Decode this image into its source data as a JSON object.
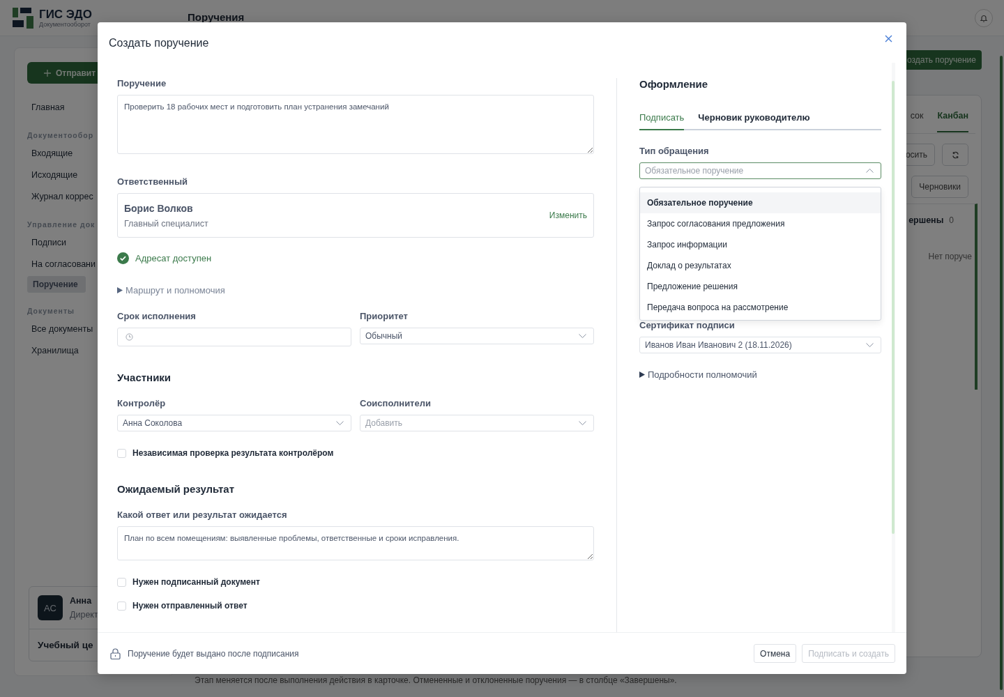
{
  "app": {
    "logo_title": "ГИС ЭДО",
    "logo_subtitle": "Документооборот",
    "page_title": "Поручения"
  },
  "sidebar": {
    "action_button": "Отправит",
    "home": {
      "label": "Главная",
      "selected": false
    },
    "sections": [
      {
        "title": "Документообор",
        "items": [
          {
            "label": "Входящие",
            "selected": false
          },
          {
            "label": "Исходящие",
            "selected": false
          },
          {
            "label": "Журнал коррес",
            "selected": false
          }
        ]
      },
      {
        "title": "Управление док",
        "items": [
          {
            "label": "Подписи",
            "selected": false
          },
          {
            "label": "На согласовани",
            "selected": false
          },
          {
            "label": "Поручение",
            "selected": true
          }
        ]
      },
      {
        "title": "Документы",
        "items": [
          {
            "label": "Все документы",
            "selected": false
          },
          {
            "label": "Хранилища",
            "selected": false
          }
        ]
      }
    ],
    "user": {
      "initials": "АС",
      "name": "Анна",
      "role": "Директ",
      "org": "Учебный це"
    }
  },
  "main": {
    "create_button": "оздать поручение",
    "view_tabs": [
      {
        "label": "сок",
        "selected": false
      },
      {
        "label": "Канбан",
        "selected": true
      }
    ],
    "reset_button": "осить",
    "filter_button": "Черновики",
    "column": {
      "title": "ершены",
      "count": "0",
      "empty": "Нет поруче"
    },
    "footnote": "Этап меняется после выполнения действия в карточке. Отмененные и отклоненные поручения — в столбце «Завершены»."
  },
  "dialog": {
    "title": "Создать поручение",
    "assignment": {
      "label": "Поручение",
      "value": "Проверить 18 рабочих мест и подготовить план устранения замечаний"
    },
    "responsible": {
      "label": "Ответственный",
      "name": "Борис Волков",
      "position": "Главный специалист",
      "change_link": "Изменить"
    },
    "availability": {
      "text": "Адресат доступен",
      "ok": true
    },
    "route_toggle": {
      "label": "Маршрут и полномочия",
      "expanded": false
    },
    "deadline": {
      "label": "Срок исполнения"
    },
    "priority": {
      "label": "Приоритет",
      "value": "Обычный"
    },
    "participants_heading": "Участники",
    "controller": {
      "label": "Контролёр",
      "value": "Анна Соколова"
    },
    "coexecutors": {
      "label": "Соисполнители",
      "placeholder": "Добавить"
    },
    "independent_check": {
      "label": "Независимая проверка результата контролёром",
      "checked": false
    },
    "result_heading": "Ожидаемый результат",
    "result": {
      "label": "Какой ответ или результат ожидается",
      "value": "План по всем помещениям: выявленные проблемы, ответственные и сроки исправления."
    },
    "result_options": [
      {
        "label": "Нужен подписанный документ",
        "checked": false
      },
      {
        "label": "Нужен отправленный ответ",
        "checked": false
      }
    ],
    "design_heading": "Оформление",
    "tabs": [
      {
        "label": "Подписать",
        "selected": true
      },
      {
        "label": "Черновик руководителю",
        "selected": false
      }
    ],
    "type": {
      "label": "Тип обращения",
      "value": "Обязательное поручение",
      "expanded": true,
      "options": [
        {
          "label": "Обязательное поручение",
          "selected": true
        },
        {
          "label": "Запрос согласования предложения",
          "selected": false
        },
        {
          "label": "Запрос информации",
          "selected": false
        },
        {
          "label": "Доклад о результатах",
          "selected": false
        },
        {
          "label": "Предложение решения",
          "selected": false
        },
        {
          "label": "Передача вопроса на рассмотрение",
          "selected": false
        }
      ]
    },
    "certificate": {
      "label": "Сертификат подписи",
      "value": "Иванов Иван Иванович 2 (18.11.2026)"
    },
    "details_toggle": {
      "label": "Подробности полномочий",
      "expanded": false
    },
    "footer_note": "Поручение будет выдано после подписания",
    "cancel_button": "Отмена",
    "submit_button": {
      "label": "Подписать и создать",
      "disabled": true
    }
  }
}
